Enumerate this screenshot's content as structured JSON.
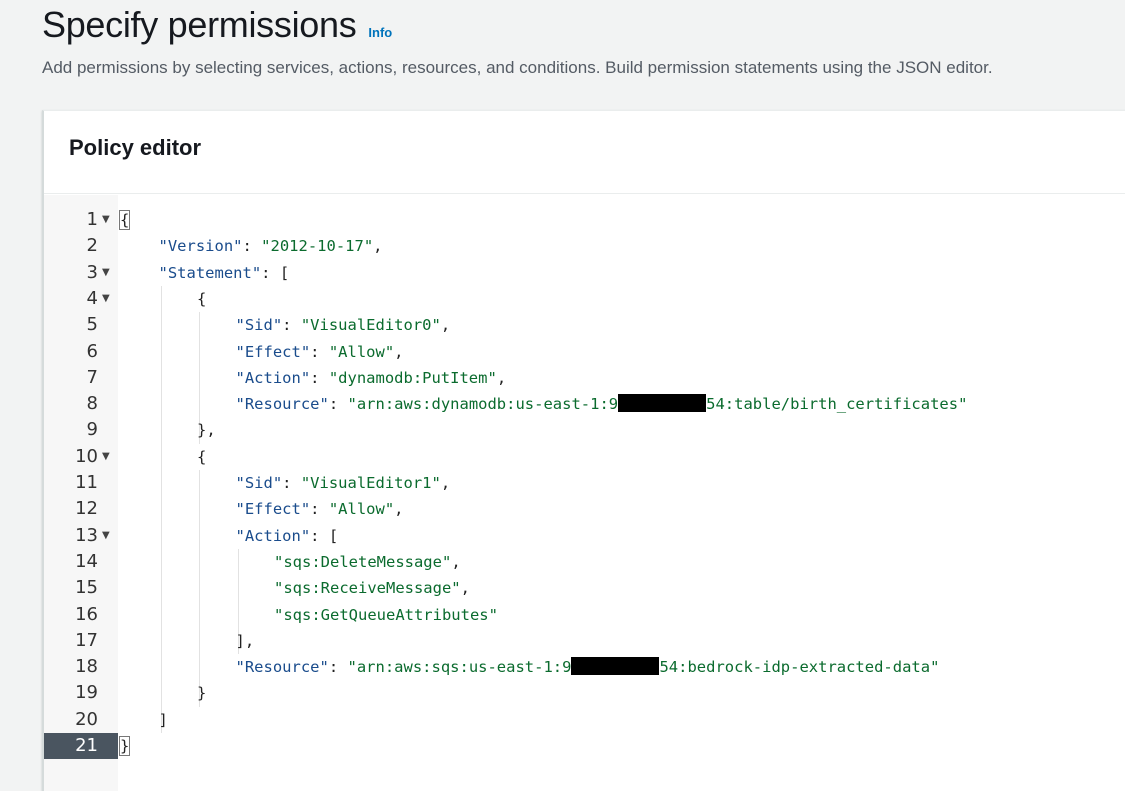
{
  "header": {
    "title": "Specify permissions",
    "info_label": "Info",
    "description": "Add permissions by selecting services, actions, resources, and conditions. Build permission statements using the JSON editor."
  },
  "panel": {
    "title": "Policy editor"
  },
  "editor": {
    "active_line": 21,
    "lines": [
      {
        "n": "1",
        "fold": true,
        "indent": 0,
        "parts": [
          [
            "p",
            "{"
          ]
        ],
        "cursor": true
      },
      {
        "n": "2",
        "fold": false,
        "indent": 1,
        "parts": [
          [
            "k",
            "\"Version\""
          ],
          [
            "p",
            ": "
          ],
          [
            "s",
            "\"2012-10-17\""
          ],
          [
            "p",
            ","
          ]
        ]
      },
      {
        "n": "3",
        "fold": true,
        "indent": 1,
        "parts": [
          [
            "k",
            "\"Statement\""
          ],
          [
            "p",
            ": ["
          ]
        ]
      },
      {
        "n": "4",
        "fold": true,
        "indent": 2,
        "parts": [
          [
            "p",
            "{"
          ]
        ]
      },
      {
        "n": "5",
        "fold": false,
        "indent": 3,
        "parts": [
          [
            "k",
            "\"Sid\""
          ],
          [
            "p",
            ": "
          ],
          [
            "s",
            "\"VisualEditor0\""
          ],
          [
            "p",
            ","
          ]
        ]
      },
      {
        "n": "6",
        "fold": false,
        "indent": 3,
        "parts": [
          [
            "k",
            "\"Effect\""
          ],
          [
            "p",
            ": "
          ],
          [
            "s",
            "\"Allow\""
          ],
          [
            "p",
            ","
          ]
        ]
      },
      {
        "n": "7",
        "fold": false,
        "indent": 3,
        "parts": [
          [
            "k",
            "\"Action\""
          ],
          [
            "p",
            ": "
          ],
          [
            "s",
            "\"dynamodb:PutItem\""
          ],
          [
            "p",
            ","
          ]
        ]
      },
      {
        "n": "8",
        "fold": false,
        "indent": 3,
        "parts": [
          [
            "k",
            "\"Resource\""
          ],
          [
            "p",
            ": "
          ],
          [
            "s",
            "\"arn:aws:dynamodb:us-east-1:9"
          ],
          [
            "r",
            "10"
          ],
          [
            "s",
            "54:table/birth_certificates\""
          ]
        ]
      },
      {
        "n": "9",
        "fold": false,
        "indent": 2,
        "parts": [
          [
            "p",
            "},"
          ]
        ]
      },
      {
        "n": "10",
        "fold": true,
        "indent": 2,
        "parts": [
          [
            "p",
            "{"
          ]
        ]
      },
      {
        "n": "11",
        "fold": false,
        "indent": 3,
        "parts": [
          [
            "k",
            "\"Sid\""
          ],
          [
            "p",
            ": "
          ],
          [
            "s",
            "\"VisualEditor1\""
          ],
          [
            "p",
            ","
          ]
        ]
      },
      {
        "n": "12",
        "fold": false,
        "indent": 3,
        "parts": [
          [
            "k",
            "\"Effect\""
          ],
          [
            "p",
            ": "
          ],
          [
            "s",
            "\"Allow\""
          ],
          [
            "p",
            ","
          ]
        ]
      },
      {
        "n": "13",
        "fold": true,
        "indent": 3,
        "parts": [
          [
            "k",
            "\"Action\""
          ],
          [
            "p",
            ": ["
          ]
        ]
      },
      {
        "n": "14",
        "fold": false,
        "indent": 4,
        "parts": [
          [
            "s",
            "\"sqs:DeleteMessage\""
          ],
          [
            "p",
            ","
          ]
        ]
      },
      {
        "n": "15",
        "fold": false,
        "indent": 4,
        "parts": [
          [
            "s",
            "\"sqs:ReceiveMessage\""
          ],
          [
            "p",
            ","
          ]
        ]
      },
      {
        "n": "16",
        "fold": false,
        "indent": 4,
        "parts": [
          [
            "s",
            "\"sqs:GetQueueAttributes\""
          ]
        ]
      },
      {
        "n": "17",
        "fold": false,
        "indent": 3,
        "parts": [
          [
            "p",
            "],"
          ]
        ]
      },
      {
        "n": "18",
        "fold": false,
        "indent": 3,
        "parts": [
          [
            "k",
            "\"Resource\""
          ],
          [
            "p",
            ": "
          ],
          [
            "s",
            "\"arn:aws:sqs:us-east-1:9"
          ],
          [
            "r",
            "10"
          ],
          [
            "s",
            "54:bedrock-idp-extracted-data\""
          ]
        ]
      },
      {
        "n": "19",
        "fold": false,
        "indent": 2,
        "parts": [
          [
            "p",
            "}"
          ]
        ]
      },
      {
        "n": "20",
        "fold": false,
        "indent": 1,
        "parts": [
          [
            "p",
            "]"
          ]
        ]
      },
      {
        "n": "21",
        "fold": false,
        "indent": 0,
        "parts": [
          [
            "p",
            "}"
          ]
        ],
        "cursor": true
      }
    ]
  }
}
